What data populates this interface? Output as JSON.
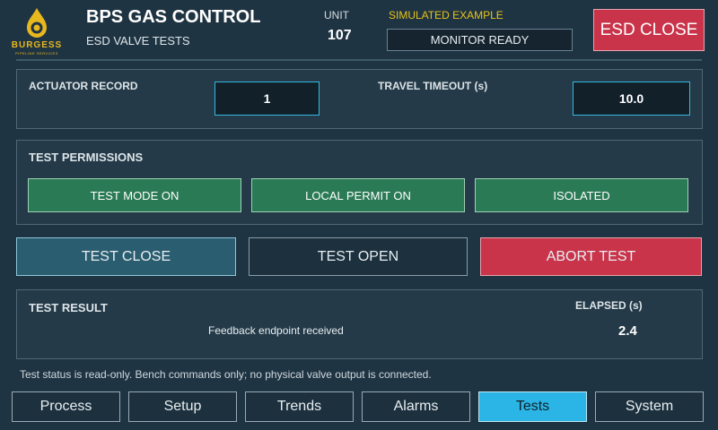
{
  "header": {
    "logo": {
      "brand": "BURGESS",
      "subtext": "PIPELINE SERVICES",
      "icon": "flame-drop-icon"
    },
    "title": "BPS GAS CONTROL",
    "subtitle": "ESD VALVE TESTS",
    "unit_label": "UNIT",
    "unit_value": "107",
    "simulated_label": "SIMULATED EXAMPLE",
    "monitor_status": "MONITOR READY",
    "esd_button": "ESD CLOSE"
  },
  "actuator": {
    "record_label": "ACTUATOR RECORD",
    "record_value": "1",
    "travel_label": "TRAVEL TIMEOUT (s)",
    "travel_value": "10.0"
  },
  "permissions": {
    "label": "TEST PERMISSIONS",
    "items": [
      {
        "label": "TEST MODE ON"
      },
      {
        "label": "LOCAL PERMIT ON"
      },
      {
        "label": "ISOLATED"
      }
    ]
  },
  "actions": {
    "test_close": "TEST CLOSE",
    "test_open": "TEST OPEN",
    "abort": "ABORT TEST"
  },
  "result": {
    "label": "TEST RESULT",
    "text": "Feedback endpoint received",
    "elapsed_label": "ELAPSED (s)",
    "elapsed_value": "2.4"
  },
  "footer_note": "Test status is read-only. Bench commands only; no physical valve output is connected.",
  "nav": {
    "active": "Tests",
    "items": [
      {
        "label": "Process"
      },
      {
        "label": "Setup"
      },
      {
        "label": "Trends"
      },
      {
        "label": "Alarms"
      },
      {
        "label": "Tests"
      },
      {
        "label": "System"
      }
    ]
  },
  "colors": {
    "background": "#1f3442",
    "esd_red": "#c9344a",
    "permit_green": "#2a7a55",
    "active_tab": "#2bb5e6",
    "warning_yellow": "#e6c21a"
  }
}
